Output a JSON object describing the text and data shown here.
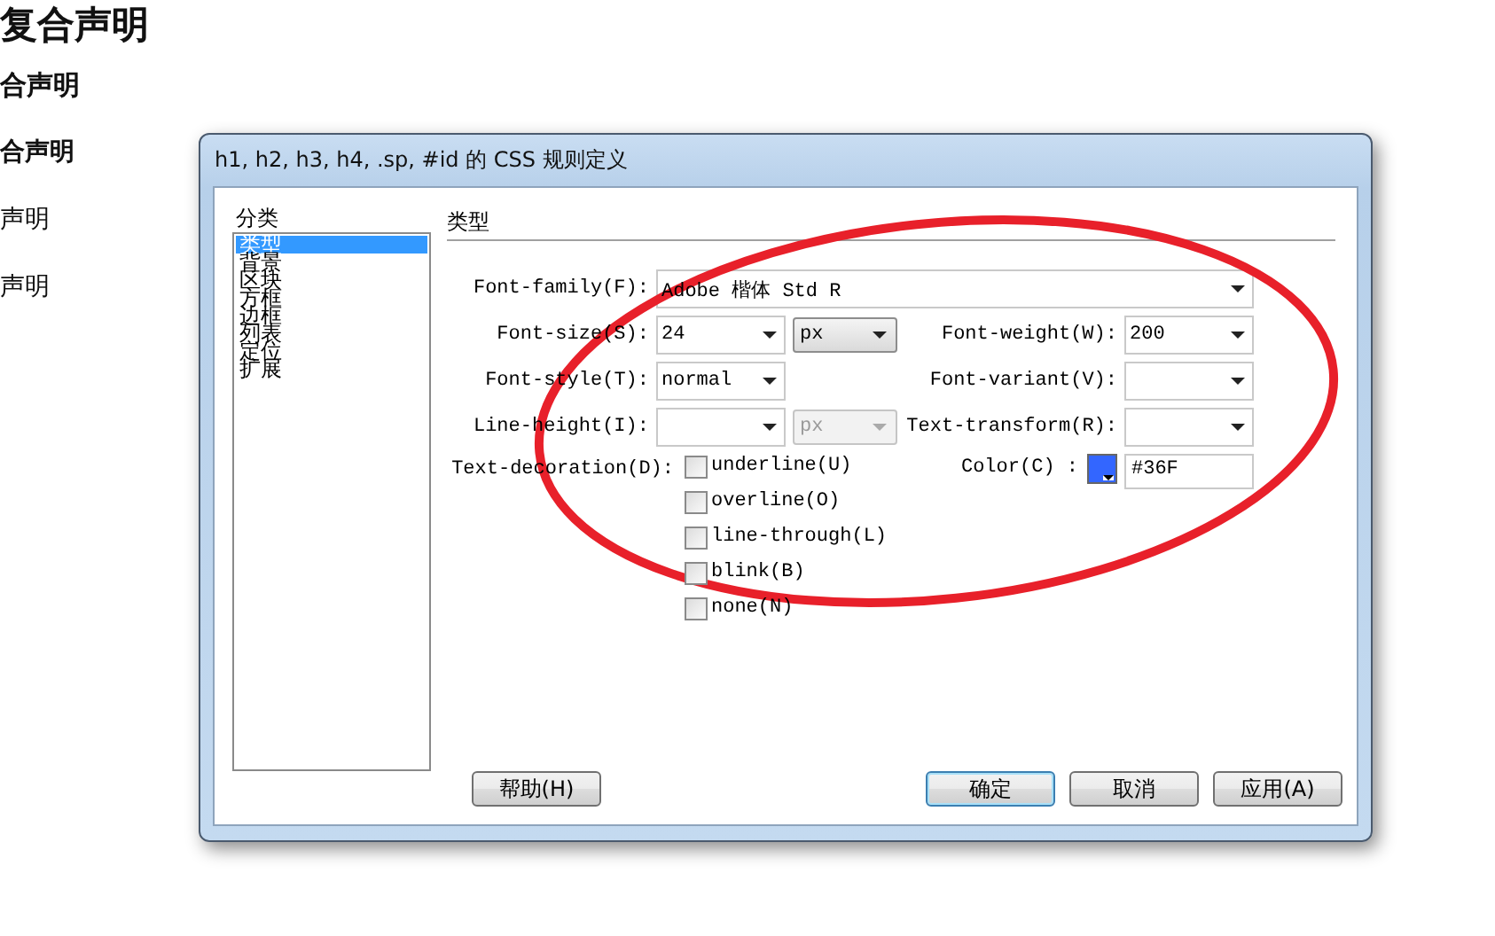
{
  "background_headings": [
    {
      "kind": "h1",
      "text": "复合声明"
    },
    {
      "kind": "h2",
      "text": "合声明"
    },
    {
      "kind": "h3",
      "text": "合声明"
    },
    {
      "kind": "p",
      "text": "声明"
    },
    {
      "kind": "p",
      "text": "声明"
    }
  ],
  "dialog": {
    "title": "h1, h2, h3, h4, .sp, #id 的 CSS 规则定义",
    "category_label": "分类",
    "categories": [
      {
        "label": "类型",
        "selected": true
      },
      {
        "label": "背景",
        "selected": false
      },
      {
        "label": "区块",
        "selected": false
      },
      {
        "label": "方框",
        "selected": false
      },
      {
        "label": "边框",
        "selected": false
      },
      {
        "label": "列表",
        "selected": false
      },
      {
        "label": "定位",
        "selected": false
      },
      {
        "label": "扩展",
        "selected": false
      }
    ],
    "section_title": "类型",
    "font_family": {
      "label": "Font-family(F):",
      "value": "Adobe 楷体 Std R"
    },
    "font_size": {
      "label": "Font-size(S):",
      "value": "24",
      "unit": "px",
      "unit_disabled": false
    },
    "font_weight": {
      "label": "Font-weight(W):",
      "value": "200"
    },
    "font_style": {
      "label": "Font-style(T):",
      "value": "normal"
    },
    "font_variant": {
      "label": "Font-variant(V):"
    },
    "line_height": {
      "label": "Line-height(I):",
      "unit": "px",
      "unit_disabled": true
    },
    "text_transform": {
      "label": "Text-transform(R):"
    },
    "color": {
      "label": "Color(C) :",
      "value": "#36F",
      "color": "#3366ff"
    },
    "text_decoration": {
      "label": "Text-decoration(D):",
      "options": [
        {
          "label": "underline(U)",
          "checked": false
        },
        {
          "label": "overline(O)",
          "checked": false
        },
        {
          "label": "line-through(L)",
          "checked": false
        },
        {
          "label": "blink(B)",
          "checked": false
        },
        {
          "label": "none(N)",
          "checked": false
        }
      ]
    },
    "help_button": {
      "label": "帮助(H)"
    },
    "buttons": [
      {
        "label": "确定",
        "default": true
      },
      {
        "label": "取消",
        "default": false
      },
      {
        "label": "应用(A)",
        "default": false
      }
    ]
  },
  "annotation": {
    "kind": "ellipse"
  }
}
